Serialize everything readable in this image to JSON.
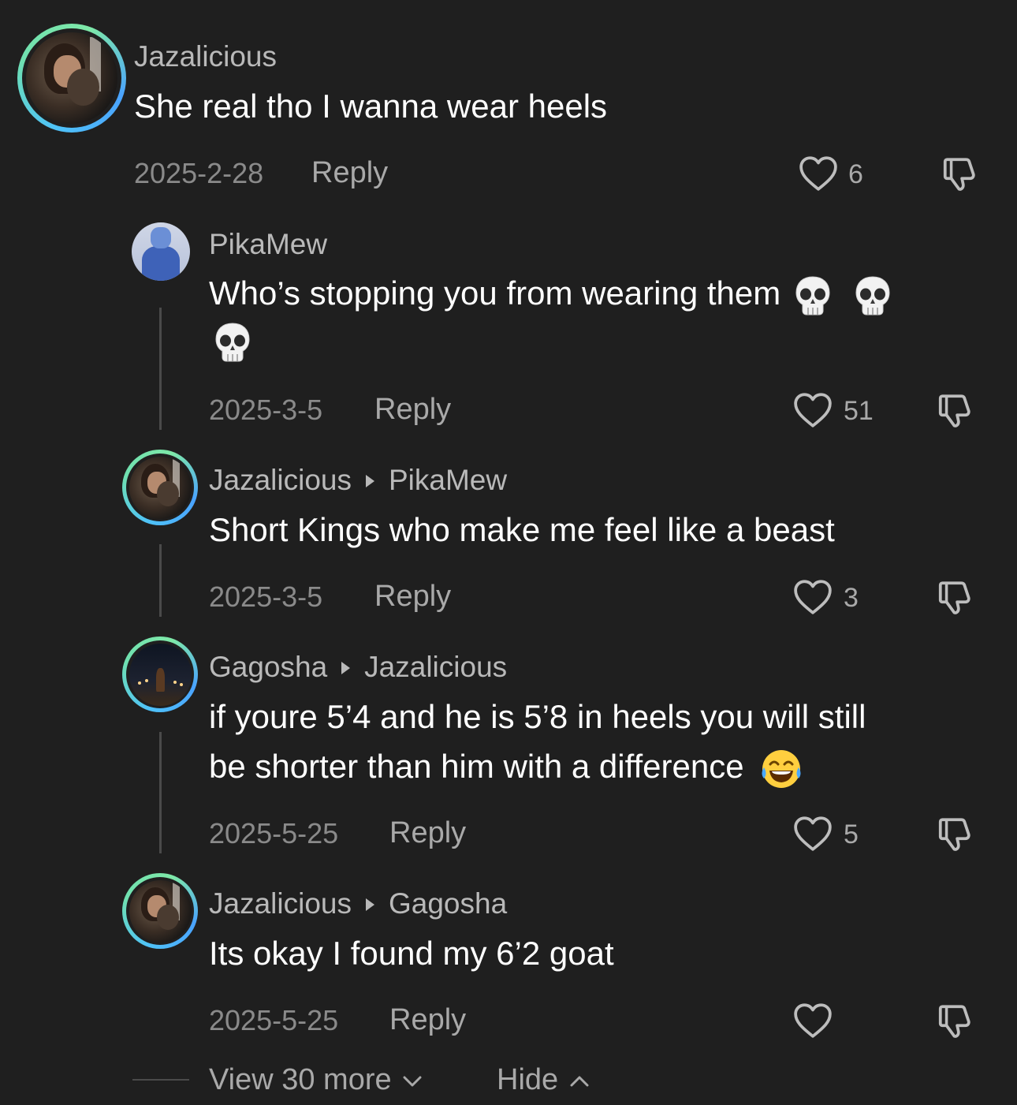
{
  "comments": [
    {
      "username": "Jazalicious",
      "reply_to": "",
      "text": "She real tho I wanna wear heels",
      "date": "2025-2-28",
      "reply_label": "Reply",
      "likes": "6"
    },
    {
      "username": "PikaMew",
      "reply_to": "",
      "text_line1": "Who’s stopping you from wearing them",
      "date": "2025-3-5",
      "reply_label": "Reply",
      "likes": "51",
      "emojis": [
        "skull",
        "skull",
        "skull"
      ]
    },
    {
      "username": "Jazalicious",
      "reply_to": "PikaMew",
      "text": "Short Kings who make me feel like a beast",
      "date": "2025-3-5",
      "reply_label": "Reply",
      "likes": "3"
    },
    {
      "username": "Gagosha",
      "reply_to": "Jazalicious",
      "text_line1": "if youre 5’4 and he is 5’8 in heels you will still",
      "text_line2": "be shorter than him with a difference",
      "date": "2025-5-25",
      "reply_label": "Reply",
      "likes": "5",
      "emojis": [
        "tears-of-joy"
      ]
    },
    {
      "username": "Jazalicious",
      "reply_to": "Gagosha",
      "text": "Its okay I found my 6’2 goat",
      "date": "2025-5-25",
      "reply_label": "Reply",
      "likes": ""
    }
  ],
  "footer": {
    "view_more_label": "View 30 more",
    "hide_label": "Hide"
  },
  "colors": {
    "background": "#1f1f1f",
    "username": "#b9b9b9",
    "meta": "#8a8a8a",
    "ring_start": "#4fc3f7",
    "ring_end": "#7ee8a8"
  }
}
